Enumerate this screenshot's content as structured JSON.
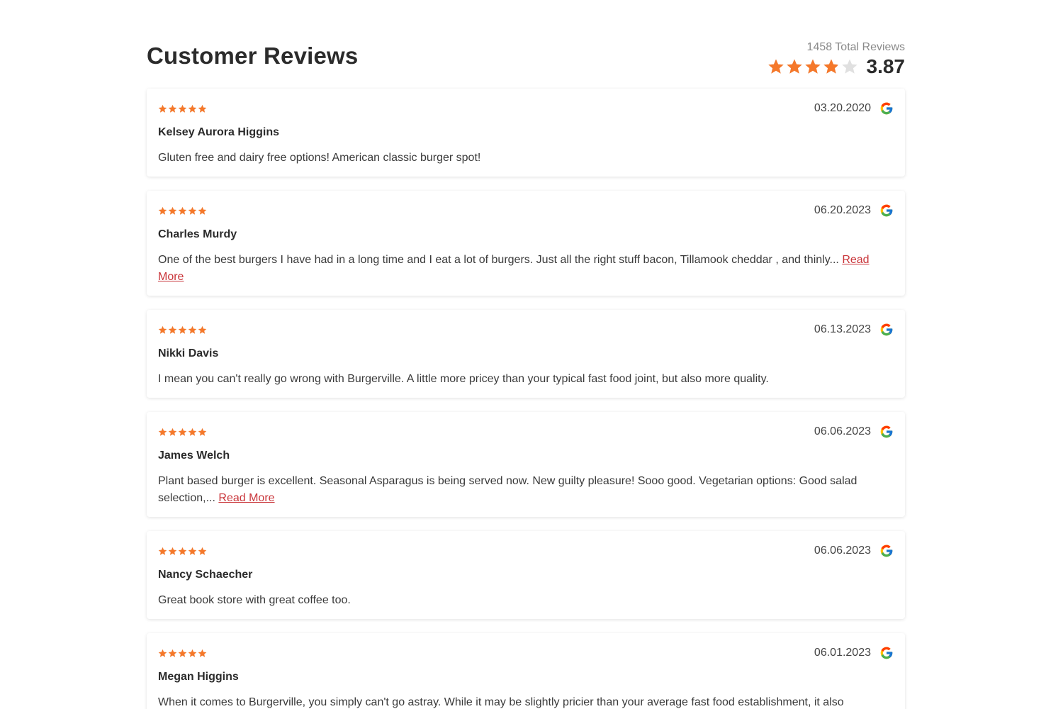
{
  "header": {
    "title": "Customer Reviews",
    "total_reviews": "1458 Total Reviews",
    "average_rating": "3.87",
    "average_value": 3.87,
    "max_stars": 5
  },
  "colors": {
    "star_filled": "#f5782a",
    "star_empty": "#e0e0e0",
    "read_more": "#c9353a"
  },
  "reviews": [
    {
      "stars": 5,
      "date": "03.20.2020",
      "source_icon": "google-icon",
      "name": "Kelsey Aurora Higgins",
      "text": "Gluten free and dairy free options! American classic burger spot!",
      "read_more": ""
    },
    {
      "stars": 5,
      "date": "06.20.2023",
      "source_icon": "google-icon",
      "name": "Charles Murdy",
      "text": "One of the best burgers I have had in a long time and I eat a lot of burgers. Just all the right stuff bacon, Tillamook cheddar , and thinly...",
      "read_more": "Read More"
    },
    {
      "stars": 5,
      "date": "06.13.2023",
      "source_icon": "google-icon",
      "name": "Nikki Davis",
      "text": "I mean you can't really go wrong with Burgerville. A little more pricey than your typical fast food joint, but also more quality.",
      "read_more": ""
    },
    {
      "stars": 5,
      "date": "06.06.2023",
      "source_icon": "google-icon",
      "name": "James Welch",
      "text": "Plant based burger is excellent. Seasonal Asparagus is being served now. New guilty pleasure! Sooo good. Vegetarian options: Good salad selection,...",
      "read_more": "Read More"
    },
    {
      "stars": 5,
      "date": "06.06.2023",
      "source_icon": "google-icon",
      "name": "Nancy Schaecher",
      "text": "Great book store with great coffee too.",
      "read_more": ""
    },
    {
      "stars": 5,
      "date": "06.01.2023",
      "source_icon": "google-icon",
      "name": "Megan Higgins",
      "text": "When it comes to Burgerville, you simply can't go astray. While it may be slightly pricier than your average fast food establishment, it also",
      "read_more": ""
    }
  ]
}
